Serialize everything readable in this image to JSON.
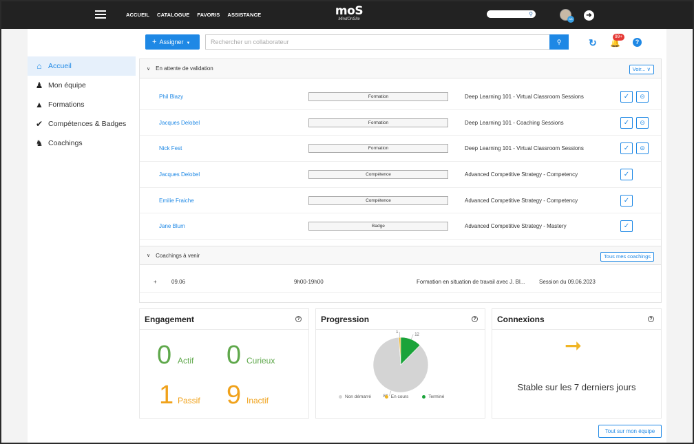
{
  "topbar": {
    "nav": [
      "ACCUEIL",
      "CATALOGUE",
      "FAVORIS",
      "ASSISTANCE"
    ],
    "logo_main": "moS",
    "logo_sub": "MindOnSite",
    "avatar_badge": "AB"
  },
  "toolbar": {
    "assign_label": "Assigner",
    "search_placeholder": "Rechercher un collaborateur",
    "notification_count": "99+"
  },
  "sidebar": {
    "items": [
      {
        "label": "Accueil",
        "icon": "home-icon",
        "active": true
      },
      {
        "label": "Mon équipe",
        "icon": "team-icon",
        "active": false
      },
      {
        "label": "Formations",
        "icon": "graduation-cap-icon",
        "active": false
      },
      {
        "label": "Compétences & Badges",
        "icon": "check-circle-icon",
        "active": false
      },
      {
        "label": "Coachings",
        "icon": "coaching-icon",
        "active": false
      }
    ]
  },
  "pending": {
    "title": "En attente de validation",
    "more_label": "Voir...",
    "rows": [
      {
        "name": "Phil Blazy",
        "type": "Formation",
        "course": "Deep Learning 101 - Virtual Classroom Sessions",
        "can_reject": true
      },
      {
        "name": "Jacques Delobel",
        "type": "Formation",
        "course": "Deep Learning 101 - Coaching Sessions",
        "can_reject": true
      },
      {
        "name": "Nick Fest",
        "type": "Formation",
        "course": "Deep Learning 101 - Virtual Classroom Sessions",
        "can_reject": true
      },
      {
        "name": "Jacques Delobel",
        "type": "Compétence",
        "course": "Advanced Competitive Strategy - Competency",
        "can_reject": false
      },
      {
        "name": "Emilie Fraiche",
        "type": "Compétence",
        "course": "Advanced Competitive Strategy - Competency",
        "can_reject": false
      },
      {
        "name": "Jane Blum",
        "type": "Badge",
        "course": "Advanced Competitive Strategy - Mastery",
        "can_reject": false
      }
    ]
  },
  "coachings": {
    "title": "Coachings à venir",
    "all_label": "Tous mes coachings",
    "rows": [
      {
        "expand": "+",
        "date": "09.06",
        "time": "9h00-19h00",
        "title": "Formation en situation de travail avec J. Bl...",
        "session": "Session du 09.06.2023"
      }
    ]
  },
  "engagement": {
    "title": "Engagement",
    "help": "?",
    "items": [
      {
        "value": "0",
        "label": "Actif",
        "color": "#5fa84b"
      },
      {
        "value": "0",
        "label": "Curieux",
        "color": "#5fa84b"
      },
      {
        "value": "1",
        "label": "Passif",
        "color": "#f0a21b"
      },
      {
        "value": "9",
        "label": "Inactif",
        "color": "#f0a21b"
      }
    ]
  },
  "progression": {
    "title": "Progression",
    "help": "?",
    "chart_data": {
      "type": "pie",
      "series": [
        {
          "name": "Non démarré",
          "value": 84,
          "color": "#d4d4d4"
        },
        {
          "name": "En cours",
          "value": 1,
          "color": "#f0b525"
        },
        {
          "name": "Terminé",
          "value": 12,
          "color": "#1aa339"
        }
      ],
      "labels": [
        "84",
        "1",
        "12"
      ]
    }
  },
  "connexions": {
    "title": "Connexions",
    "help": "?",
    "text": "Stable sur les 7 derniers jours",
    "icon": "arrow-right-icon"
  },
  "footer": {
    "team_label": "Tout sur mon équipe"
  }
}
